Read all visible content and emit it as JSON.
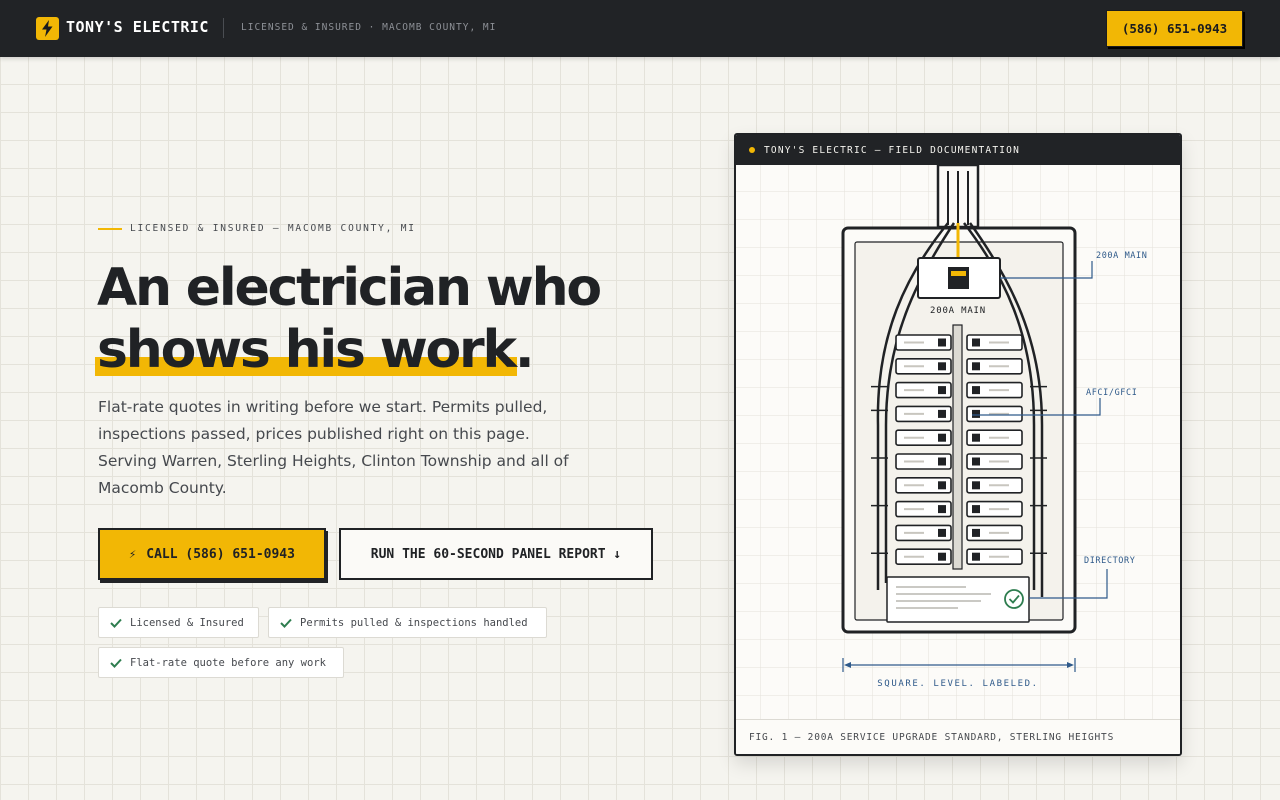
{
  "header": {
    "brand": "TONY'S ELECTRIC",
    "tagline": "LICENSED & INSURED · MACOMB COUNTY, MI",
    "phone_button": "(586) 651-0943",
    "logo_icon": "lightning-bolt-icon"
  },
  "hero": {
    "eyebrow": "LICENSED & INSURED — MACOMB COUNTY, MI",
    "headline_line1": "An electrician who",
    "headline_line2": "shows his work.",
    "lead": "Flat-rate quotes in writing before we start. Permits pulled, inspections passed, prices published right on this page. Serving Warren, Sterling Heights, Clinton Township and all of Macomb County.",
    "cta_call_icon": "⚡",
    "cta_call_label": "CALL (586) 651-0943",
    "cta_report_label": "RUN THE 60-SECOND PANEL REPORT ↓",
    "badges": [
      {
        "label": "Licensed & Insured",
        "icon": "check-icon"
      },
      {
        "label": "Permits pulled & inspections handled",
        "icon": "check-icon"
      },
      {
        "label": "Flat-rate quote before any work",
        "icon": "check-icon"
      }
    ]
  },
  "diagram": {
    "card_title": "TONY'S ELECTRIC — FIELD DOCUMENTATION",
    "main_label": "200A MAIN",
    "callouts": {
      "main": "200A MAIN",
      "afci": "AFCI/GFCI",
      "directory": "DIRECTORY"
    },
    "dimension_caption": "SQUARE. LEVEL. LABELED.",
    "figure_caption": "FIG. 1 — 200A SERVICE UPGRADE STANDARD, STERLING HEIGHTS"
  },
  "colors": {
    "accent": "#f2b705",
    "dark": "#212326",
    "blueprint": "#2f5a8a",
    "check": "#2e7d4f"
  }
}
